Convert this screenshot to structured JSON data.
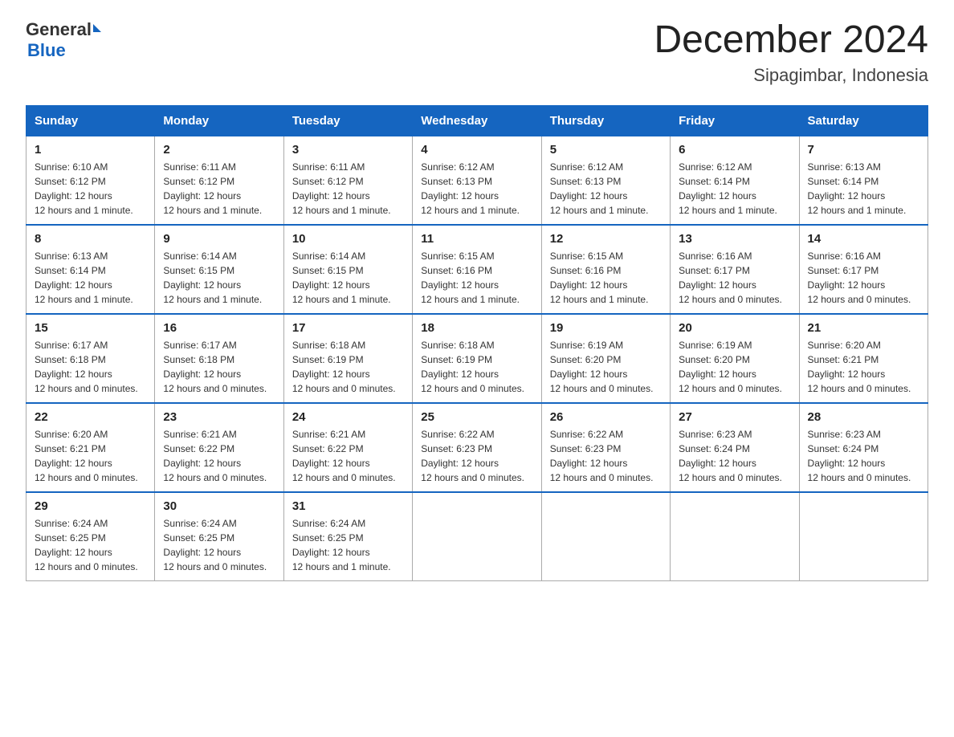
{
  "header": {
    "logo": {
      "general": "General",
      "blue": "Blue"
    },
    "title": "December 2024",
    "location": "Sipagimbar, Indonesia"
  },
  "columns": [
    "Sunday",
    "Monday",
    "Tuesday",
    "Wednesday",
    "Thursday",
    "Friday",
    "Saturday"
  ],
  "weeks": [
    [
      {
        "day": "1",
        "sunrise": "6:10 AM",
        "sunset": "6:12 PM",
        "daylight": "12 hours and 1 minute."
      },
      {
        "day": "2",
        "sunrise": "6:11 AM",
        "sunset": "6:12 PM",
        "daylight": "12 hours and 1 minute."
      },
      {
        "day": "3",
        "sunrise": "6:11 AM",
        "sunset": "6:12 PM",
        "daylight": "12 hours and 1 minute."
      },
      {
        "day": "4",
        "sunrise": "6:12 AM",
        "sunset": "6:13 PM",
        "daylight": "12 hours and 1 minute."
      },
      {
        "day": "5",
        "sunrise": "6:12 AM",
        "sunset": "6:13 PM",
        "daylight": "12 hours and 1 minute."
      },
      {
        "day": "6",
        "sunrise": "6:12 AM",
        "sunset": "6:14 PM",
        "daylight": "12 hours and 1 minute."
      },
      {
        "day": "7",
        "sunrise": "6:13 AM",
        "sunset": "6:14 PM",
        "daylight": "12 hours and 1 minute."
      }
    ],
    [
      {
        "day": "8",
        "sunrise": "6:13 AM",
        "sunset": "6:14 PM",
        "daylight": "12 hours and 1 minute."
      },
      {
        "day": "9",
        "sunrise": "6:14 AM",
        "sunset": "6:15 PM",
        "daylight": "12 hours and 1 minute."
      },
      {
        "day": "10",
        "sunrise": "6:14 AM",
        "sunset": "6:15 PM",
        "daylight": "12 hours and 1 minute."
      },
      {
        "day": "11",
        "sunrise": "6:15 AM",
        "sunset": "6:16 PM",
        "daylight": "12 hours and 1 minute."
      },
      {
        "day": "12",
        "sunrise": "6:15 AM",
        "sunset": "6:16 PM",
        "daylight": "12 hours and 1 minute."
      },
      {
        "day": "13",
        "sunrise": "6:16 AM",
        "sunset": "6:17 PM",
        "daylight": "12 hours and 0 minutes."
      },
      {
        "day": "14",
        "sunrise": "6:16 AM",
        "sunset": "6:17 PM",
        "daylight": "12 hours and 0 minutes."
      }
    ],
    [
      {
        "day": "15",
        "sunrise": "6:17 AM",
        "sunset": "6:18 PM",
        "daylight": "12 hours and 0 minutes."
      },
      {
        "day": "16",
        "sunrise": "6:17 AM",
        "sunset": "6:18 PM",
        "daylight": "12 hours and 0 minutes."
      },
      {
        "day": "17",
        "sunrise": "6:18 AM",
        "sunset": "6:19 PM",
        "daylight": "12 hours and 0 minutes."
      },
      {
        "day": "18",
        "sunrise": "6:18 AM",
        "sunset": "6:19 PM",
        "daylight": "12 hours and 0 minutes."
      },
      {
        "day": "19",
        "sunrise": "6:19 AM",
        "sunset": "6:20 PM",
        "daylight": "12 hours and 0 minutes."
      },
      {
        "day": "20",
        "sunrise": "6:19 AM",
        "sunset": "6:20 PM",
        "daylight": "12 hours and 0 minutes."
      },
      {
        "day": "21",
        "sunrise": "6:20 AM",
        "sunset": "6:21 PM",
        "daylight": "12 hours and 0 minutes."
      }
    ],
    [
      {
        "day": "22",
        "sunrise": "6:20 AM",
        "sunset": "6:21 PM",
        "daylight": "12 hours and 0 minutes."
      },
      {
        "day": "23",
        "sunrise": "6:21 AM",
        "sunset": "6:22 PM",
        "daylight": "12 hours and 0 minutes."
      },
      {
        "day": "24",
        "sunrise": "6:21 AM",
        "sunset": "6:22 PM",
        "daylight": "12 hours and 0 minutes."
      },
      {
        "day": "25",
        "sunrise": "6:22 AM",
        "sunset": "6:23 PM",
        "daylight": "12 hours and 0 minutes."
      },
      {
        "day": "26",
        "sunrise": "6:22 AM",
        "sunset": "6:23 PM",
        "daylight": "12 hours and 0 minutes."
      },
      {
        "day": "27",
        "sunrise": "6:23 AM",
        "sunset": "6:24 PM",
        "daylight": "12 hours and 0 minutes."
      },
      {
        "day": "28",
        "sunrise": "6:23 AM",
        "sunset": "6:24 PM",
        "daylight": "12 hours and 0 minutes."
      }
    ],
    [
      {
        "day": "29",
        "sunrise": "6:24 AM",
        "sunset": "6:25 PM",
        "daylight": "12 hours and 0 minutes."
      },
      {
        "day": "30",
        "sunrise": "6:24 AM",
        "sunset": "6:25 PM",
        "daylight": "12 hours and 0 minutes."
      },
      {
        "day": "31",
        "sunrise": "6:24 AM",
        "sunset": "6:25 PM",
        "daylight": "12 hours and 1 minute."
      },
      null,
      null,
      null,
      null
    ]
  ],
  "labels": {
    "sunrise": "Sunrise:",
    "sunset": "Sunset:",
    "daylight": "Daylight:"
  }
}
